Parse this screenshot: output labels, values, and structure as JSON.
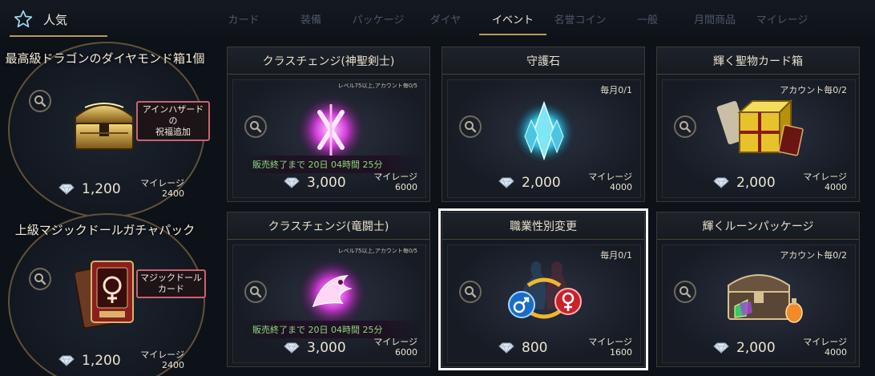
{
  "header": {
    "popular_label": "人気",
    "tabs": [
      {
        "label": "カード"
      },
      {
        "label": "装備"
      },
      {
        "label": "パッケージ"
      },
      {
        "label": "ダイヤ"
      },
      {
        "label": "イベント"
      },
      {
        "label": "名誉コイン"
      },
      {
        "label": "一般"
      },
      {
        "label": "月間商品"
      },
      {
        "label": "マイレージ"
      }
    ],
    "active_tab": "イベント"
  },
  "popular": [
    {
      "title": "最高級ドラゴンのダイヤモンド箱1個",
      "badge_line1": "アインハザードの",
      "badge_line2": "祝福追加",
      "price": "1,200",
      "mileage_label": "マイレージ",
      "mileage_value": "2400"
    },
    {
      "title": "上級マジックドールガチャパック",
      "badge_line1": "マジックドール",
      "badge_line2": "カード",
      "price": "1,200",
      "mileage_label": "マイレージ",
      "mileage_value": "2400"
    }
  ],
  "cards": [
    {
      "title": "クラスチェンジ(神聖剣士)",
      "limit": "レベル75以上,アカウント毎0/5",
      "timer": "販売終了まで  20日  04時間  25分",
      "price": "3,000",
      "mileage_label": "マイレージ",
      "mileage_value": "6000"
    },
    {
      "title": "守護石",
      "limit": "毎月0/1",
      "price": "2,000",
      "mileage_label": "マイレージ",
      "mileage_value": "4000"
    },
    {
      "title": "輝く聖物カード箱",
      "limit": "アカウント毎0/2",
      "price": "2,000",
      "mileage_label": "マイレージ",
      "mileage_value": "4000"
    },
    {
      "title": "クラスチェンジ(竜闘士)",
      "limit": "レベル75以上,アカウント毎0/5",
      "timer": "販売終了まで  20日  04時間  25分",
      "price": "3,000",
      "mileage_label": "マイレージ",
      "mileage_value": "6000"
    },
    {
      "title": "職業性別変更",
      "limit": "毎月0/1",
      "price": "800",
      "mileage_label": "マイレージ",
      "mileage_value": "1600"
    },
    {
      "title": "輝くルーンパッケージ",
      "limit": "アカウント毎0/2",
      "price": "2,000",
      "mileage_label": "マイレージ",
      "mileage_value": "4000"
    }
  ],
  "colors": {
    "accent_gold": "#b59a5b",
    "timer_green": "#8fd77a",
    "badge_border": "#c9636f",
    "selected_outline": "#ffffff"
  },
  "icons": [
    "star-icon",
    "magnifier-icon",
    "diamond-icon"
  ]
}
